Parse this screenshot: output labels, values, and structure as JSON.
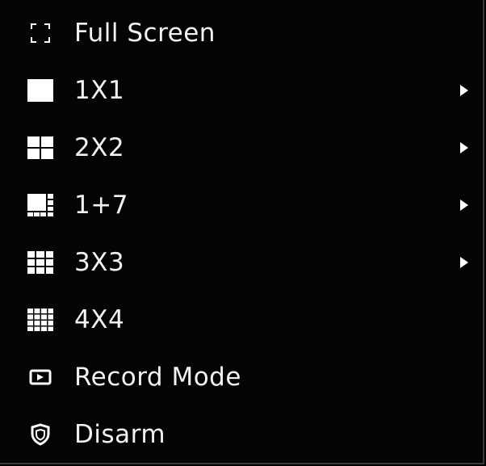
{
  "menu": {
    "items": [
      {
        "label": "Full Screen",
        "icon": "fullscreen-icon",
        "submenu": false
      },
      {
        "label": "1X1",
        "icon": "layout-1x1-icon",
        "submenu": true
      },
      {
        "label": "2X2",
        "icon": "layout-2x2-icon",
        "submenu": true
      },
      {
        "label": "1+7",
        "icon": "layout-1plus7-icon",
        "submenu": true
      },
      {
        "label": "3X3",
        "icon": "layout-3x3-icon",
        "submenu": true
      },
      {
        "label": "4X4",
        "icon": "layout-4x4-icon",
        "submenu": false
      },
      {
        "label": "Record Mode",
        "icon": "record-mode-icon",
        "submenu": false
      },
      {
        "label": "Disarm",
        "icon": "shield-icon",
        "submenu": false
      }
    ]
  },
  "colors": {
    "background": "#050505",
    "text": "#f2f2f2",
    "icon": "#ffffff",
    "border": "#3a3a3a"
  }
}
